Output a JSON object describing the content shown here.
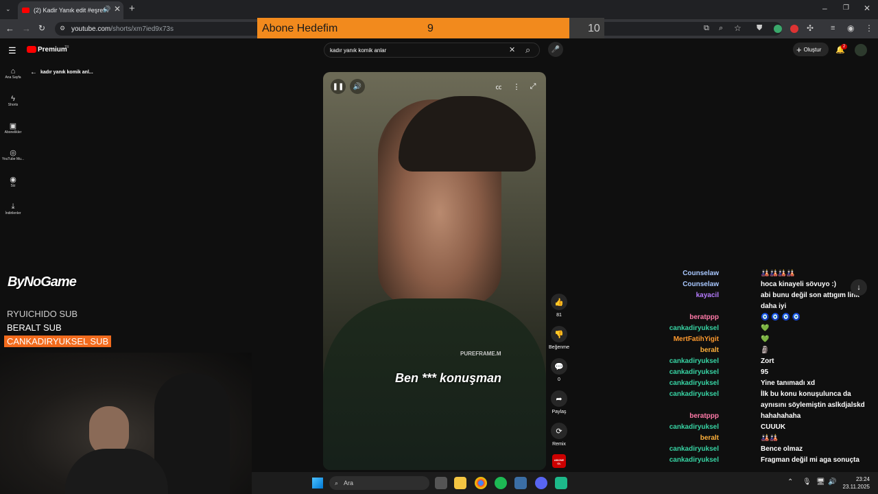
{
  "browser": {
    "tab_title": "(2) Kadir Yanık edit #eşrefrı",
    "url_domain": "youtube.com",
    "url_path": "/shorts/xm7ied9x73s"
  },
  "goal": {
    "label": "Abone Hedefim",
    "current": "9",
    "target": "10"
  },
  "youtube": {
    "logo_text": "Premium",
    "region": "TR",
    "search_value": "kadır yanık komik anlar",
    "back_label": "kadır yanık komik anl...",
    "create_label": "Oluştur",
    "notif_count": "2",
    "sidebar": [
      {
        "icon": "home-icon",
        "label": "Ana Sayfa"
      },
      {
        "icon": "shorts-icon",
        "label": "Shorts"
      },
      {
        "icon": "subscriptions-icon",
        "label": "Abonelikler"
      },
      {
        "icon": "youtube-music-icon",
        "label": "YouTube Mu..."
      },
      {
        "icon": "you-icon",
        "label": "Siz"
      },
      {
        "icon": "download-icon",
        "label": "İndirilenler"
      }
    ],
    "video": {
      "caption": "Ben *** konuşman",
      "watermark": "PUREFRAME.M"
    },
    "actions": {
      "like_count": "81",
      "dislike_label": "Beğenme",
      "comment_count": "0",
      "share_label": "Paylaş",
      "remix_label": "Remix",
      "subscribe_label": "ABONE OL"
    }
  },
  "stream": {
    "logo": "ByNoGame",
    "subs": [
      {
        "name": "RYUICHIDO",
        "tag": "SUB"
      },
      {
        "name": "BERALT",
        "tag": "SUB"
      },
      {
        "name": "CANKADIRYUKSEL",
        "tag": "SUB"
      }
    ]
  },
  "chat": [
    {
      "user": "Counselaw",
      "color": "#a9c8ff",
      "msg": "🎎🎎🎎🎎"
    },
    {
      "user": "Counselaw",
      "color": "#a9c8ff",
      "msg": "hoca kinayeli sövuyo :)"
    },
    {
      "user": "kayacil",
      "color": "#b77cff",
      "msg": "abi bunu değil son attıgım link daha iyi"
    },
    {
      "user": "beratppp",
      "color": "#ff7aa8",
      "msg": "🧿 🧿 🧿 🧿"
    },
    {
      "user": "cankadiryuksel",
      "color": "#37d3a3",
      "msg": "💚"
    },
    {
      "user": "MertFatihYigit",
      "color": "#ff9a2e",
      "msg": "💚"
    },
    {
      "user": "beralt",
      "color": "#ffb03b",
      "msg": "🗿"
    },
    {
      "user": "cankadiryuksel",
      "color": "#37d3a3",
      "msg": "Zort"
    },
    {
      "user": "cankadiryuksel",
      "color": "#37d3a3",
      "msg": "95"
    },
    {
      "user": "cankadiryuksel",
      "color": "#37d3a3",
      "msg": "Yine tanımadı xd"
    },
    {
      "user": "cankadiryuksel",
      "color": "#37d3a3",
      "msg": "İlk bu konu konuşulunca da aynısını söylemiştin aslkdjalskd"
    },
    {
      "user": "beratppp",
      "color": "#ff7aa8",
      "msg": "hahahahaha"
    },
    {
      "user": "cankadiryuksel",
      "color": "#37d3a3",
      "msg": "CUUUK"
    },
    {
      "user": "beralt",
      "color": "#ffb03b",
      "msg": "🎎🎎"
    },
    {
      "user": "cankadiryuksel",
      "color": "#37d3a3",
      "msg": "Bence olmaz"
    },
    {
      "user": "cankadiryuksel",
      "color": "#37d3a3",
      "msg": "Fragman değil mi aga sonuçta"
    }
  ],
  "taskbar": {
    "search_placeholder": "Ara",
    "time": "23:24",
    "date": "23.11.2025"
  },
  "colors": {
    "goal_fill": "#f28a1d",
    "yt_red": "#ff0000",
    "sub_highlight": "#f26b1d"
  }
}
